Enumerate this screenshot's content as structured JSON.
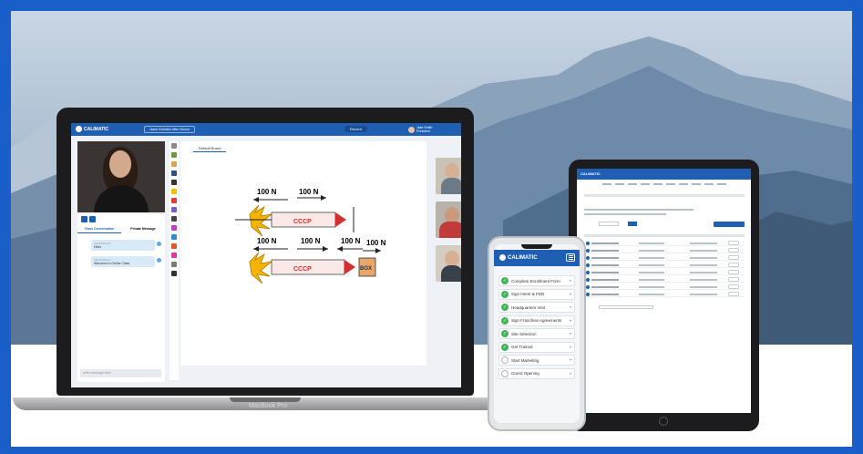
{
  "laptop": {
    "label": "MacBook Pro",
    "app": {
      "brand": "CALIMATIC",
      "school": "Jason Robotics After School",
      "record_label": "Record",
      "user_name": "Jake Smith",
      "user_role": "President"
    },
    "chat": {
      "tabs": [
        "Class Conversation",
        "Private Message"
      ],
      "messages": [
        {
          "who": "You  10:21 pm",
          "text": "Hello"
        },
        {
          "who": "You  10:22 pm",
          "text": "Welcome to Online Class"
        }
      ],
      "input_placeholder": "write message here"
    },
    "whiteboard": {
      "tab_label": "Default Board",
      "force_labels": [
        "100 N",
        "100 N",
        "100 N",
        "100 N",
        "100 N",
        "100 N"
      ],
      "rocket_text": [
        "CCCP",
        "CCCP"
      ],
      "box_label": "BOX"
    }
  },
  "phone": {
    "brand": "CALIMATIC",
    "steps": [
      {
        "label": "Complete Enrollment Form",
        "done": true
      },
      {
        "label": "Sign Intent & FDD",
        "done": true
      },
      {
        "label": "Headquarters Visit",
        "done": true
      },
      {
        "label": "Sign Franchise Agreements",
        "done": true
      },
      {
        "label": "Site Selection",
        "done": true
      },
      {
        "label": "Get Trained",
        "done": true
      },
      {
        "label": "Start Marketing",
        "done": false
      },
      {
        "label": "Grand Opening",
        "done": false
      }
    ]
  },
  "tablet": {
    "brand": "CALIMATIC"
  },
  "colors": {
    "frame": "#1a5fc9",
    "brand": "#1f5fb3",
    "check": "#45b35a"
  }
}
